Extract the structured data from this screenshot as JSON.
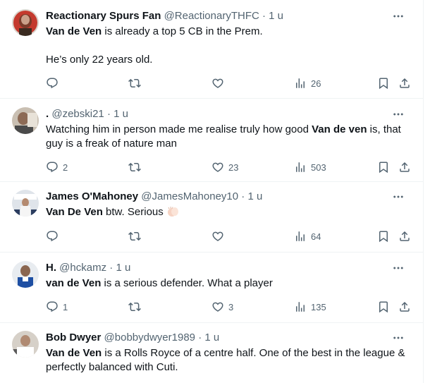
{
  "tweets": [
    {
      "name": "Reactionary Spurs Fan",
      "handle": "@ReactionaryTHFC",
      "dot": "·",
      "time": "1 u",
      "lines": [
        {
          "bold": "Van de Ven",
          "rest": " is already a top 5 CB in the Prem."
        },
        {
          "text": "He’s only 22 years old."
        }
      ],
      "replies": "",
      "retweets": "",
      "likes": "",
      "views": "26"
    },
    {
      "name": ".",
      "handle": "@zebski21",
      "dot": "·",
      "time": "1 u",
      "pre": "Watching him in person made me realise truly how good ",
      "bold": "Van de ven",
      "post": " is, that guy is a freak of nature man",
      "replies": "2",
      "retweets": "",
      "likes": "23",
      "views": "503"
    },
    {
      "name": "James O'Mahoney",
      "handle": "@JamesMahoney10",
      "dot": "·",
      "time": "1 u",
      "bold": "Van De Ven",
      "post": " btw. Serious ",
      "emoji": "clapping-hands-emoji",
      "replies": "",
      "retweets": "",
      "likes": "",
      "views": "64"
    },
    {
      "name": "H.",
      "handle": "@hckamz",
      "dot": "·",
      "time": "1 u",
      "bold": "van de Ven",
      "post": " is a serious defender. What a player",
      "replies": "1",
      "retweets": "",
      "likes": "3",
      "views": "135"
    },
    {
      "name": "Bob Dwyer",
      "handle": "@bobbydwyer1989",
      "dot": "·",
      "time": "1 u",
      "bold": "Van de Ven",
      "post": " is a Rolls Royce of a centre half. One of the best in the league &",
      "line2": "perfectly balanced with Cuti."
    }
  ],
  "icons": {
    "reply": "reply-icon",
    "retweet": "retweet-icon",
    "like": "heart-icon",
    "views": "views-icon",
    "bookmark": "bookmark-icon",
    "share": "share-icon",
    "more": "more-icon"
  },
  "colors": {
    "text": "#0f1419",
    "secondary": "#536471",
    "divider": "#eff3f4"
  }
}
